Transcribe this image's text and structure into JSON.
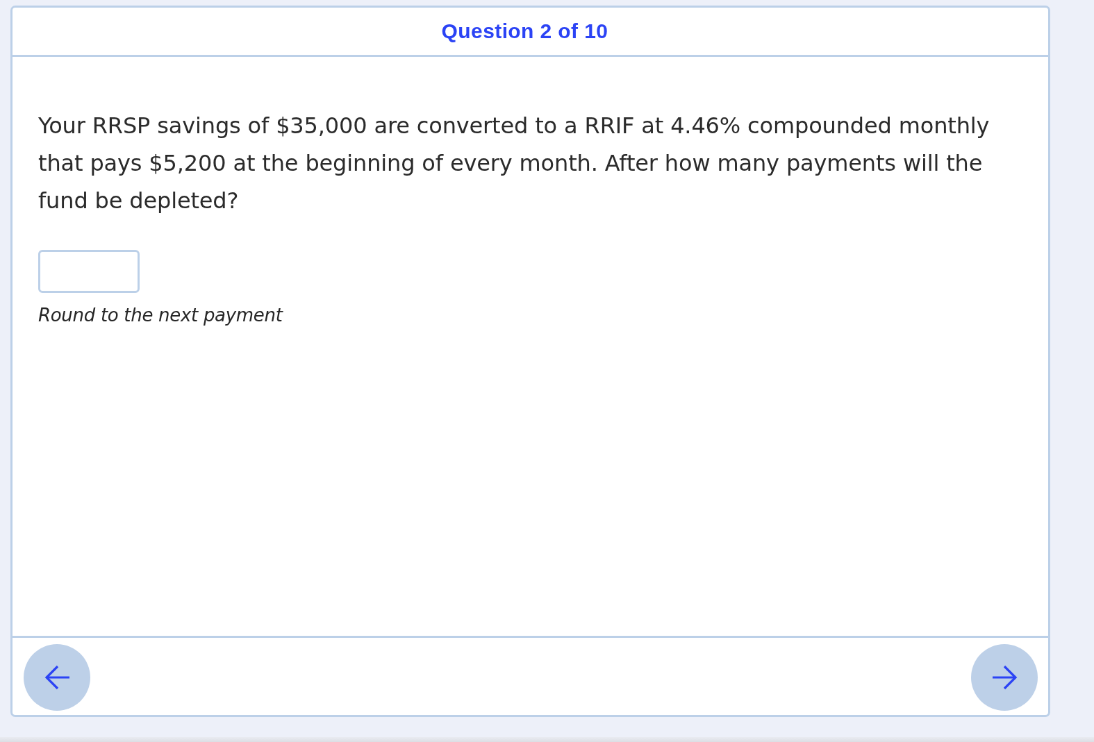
{
  "header": {
    "title": "Question 2 of 10"
  },
  "question": {
    "text": "Your RRSP savings of $35,000 are converted to a RRIF at 4.46% compounded monthly that pays $5,200 at the beginning of every month. After how many payments will the fund be depleted?",
    "answer_note": "Round to the next payment"
  },
  "navigation": {
    "buttons": [
      {
        "kind": "previous"
      },
      {
        "kind": "next"
      }
    ]
  }
}
